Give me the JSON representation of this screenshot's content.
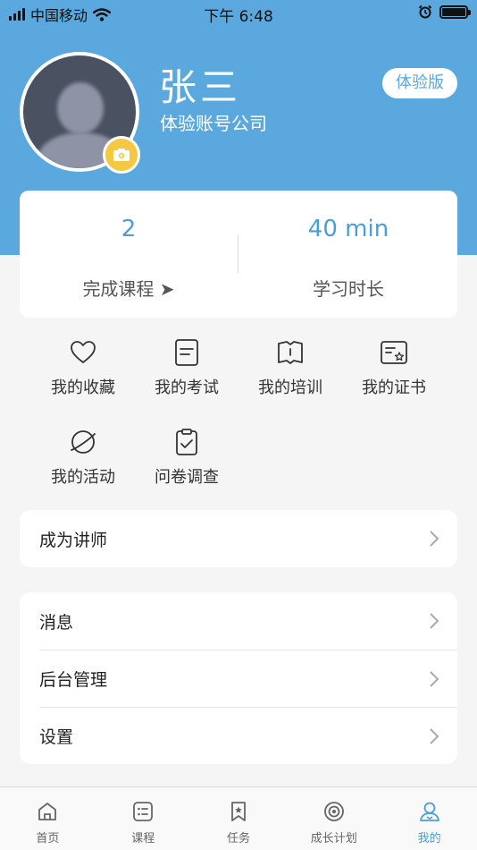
{
  "status_bar": {
    "carrier": "中国移动",
    "time": "下午 6:48"
  },
  "profile": {
    "name": "张三",
    "company": "体验账号公司",
    "badge_label": "体验版"
  },
  "stats": [
    {
      "value": "2",
      "label": "完成课程 ➤"
    },
    {
      "value": "40 min",
      "label": "学习时长"
    }
  ],
  "features": [
    {
      "label": "我的收藏",
      "icon": "heart-icon"
    },
    {
      "label": "我的考试",
      "icon": "exam-icon"
    },
    {
      "label": "我的培训",
      "icon": "book-icon"
    },
    {
      "label": "我的证书",
      "icon": "certificate-icon"
    },
    {
      "label": "我的活动",
      "icon": "planet-icon"
    },
    {
      "label": "问卷调查",
      "icon": "clipboard-icon"
    }
  ],
  "menu_teacher": {
    "label": "成为讲师"
  },
  "menu_main": [
    {
      "label": "消息"
    },
    {
      "label": "后台管理"
    },
    {
      "label": "设置"
    }
  ],
  "tabs": [
    {
      "label": "首页",
      "icon": "home-icon"
    },
    {
      "label": "课程",
      "icon": "course-list-icon"
    },
    {
      "label": "任务",
      "icon": "bookmark-star-icon"
    },
    {
      "label": "成长计划",
      "icon": "target-icon"
    },
    {
      "label": "我的",
      "icon": "user-icon",
      "active": true
    }
  ],
  "colors": {
    "primary": "#5ba8de",
    "accent_text": "#4a9fd8",
    "camera_badge": "#f5c842",
    "background": "#f5f5f5"
  }
}
